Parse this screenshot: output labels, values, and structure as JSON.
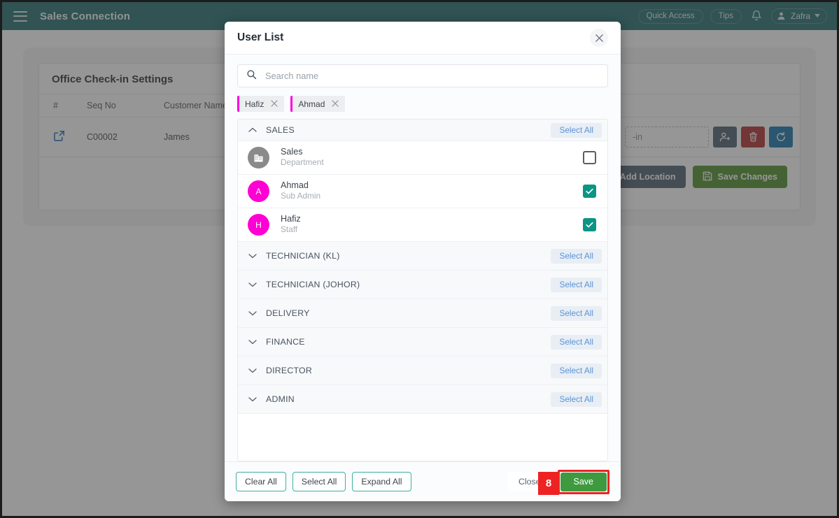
{
  "app": {
    "title": "Sales Connection",
    "menu_icon": "hamburger-icon",
    "header_actions": {
      "quick_access": "Quick Access",
      "tips": "Tips",
      "bell": "bell-icon",
      "user_name": "Zafra"
    }
  },
  "background": {
    "card_title": "Office Check-in Settings",
    "table": {
      "columns": [
        "#",
        "Seq No",
        "Customer Name"
      ],
      "rows": [
        {
          "icon": "external-link-icon",
          "seq_no": "C00002",
          "customer_name": "James"
        }
      ],
      "checkin_field_text": "-in"
    },
    "row_icon_buttons": [
      {
        "name": "assign-user-button",
        "icon": "user-add-icon",
        "color": "#4a5d6b"
      },
      {
        "name": "delete-button",
        "icon": "trash-icon",
        "color": "#b02a2a"
      },
      {
        "name": "refresh-button",
        "icon": "refresh-icon",
        "color": "#1271a8"
      }
    ],
    "buttons": {
      "add_location": "Add Location",
      "save_changes": "Save Changes"
    }
  },
  "modal": {
    "title": "User List",
    "close_icon": "close-icon",
    "search": {
      "placeholder": "Search name",
      "value": "",
      "icon": "search-icon"
    },
    "chips": [
      {
        "label": "Hafiz",
        "remove_icon": "close-icon"
      },
      {
        "label": "Ahmad",
        "remove_icon": "close-icon"
      }
    ],
    "select_all_label": "Select All",
    "groups": [
      {
        "name": "SALES",
        "expanded": true,
        "chevron": "chevron-up-icon",
        "members": [
          {
            "name": "Sales",
            "role": "Department",
            "avatar_type": "department",
            "avatar_initial": "",
            "checked": false
          },
          {
            "name": "Ahmad",
            "role": "Sub Admin",
            "avatar_type": "person",
            "avatar_initial": "A",
            "checked": true
          },
          {
            "name": "Hafiz",
            "role": "Staff",
            "avatar_type": "person",
            "avatar_initial": "H",
            "checked": true
          }
        ]
      },
      {
        "name": "TECHNICIAN (KL)",
        "expanded": false,
        "chevron": "chevron-down-icon",
        "members": []
      },
      {
        "name": "TECHNICIAN (JOHOR)",
        "expanded": false,
        "chevron": "chevron-down-icon",
        "members": []
      },
      {
        "name": "DELIVERY",
        "expanded": false,
        "chevron": "chevron-down-icon",
        "members": []
      },
      {
        "name": "FINANCE",
        "expanded": false,
        "chevron": "chevron-down-icon",
        "members": []
      },
      {
        "name": "DIRECTOR",
        "expanded": false,
        "chevron": "chevron-down-icon",
        "members": []
      },
      {
        "name": "ADMIN",
        "expanded": false,
        "chevron": "chevron-down-icon",
        "members": []
      }
    ],
    "footer": {
      "clear_all": "Clear All",
      "select_all": "Select All",
      "expand_all": "Expand All",
      "close": "Close",
      "save": "Save"
    }
  },
  "annotation": {
    "step_number": "8"
  },
  "colors": {
    "topbar": "#1f6a6a",
    "accent_teal": "#0c9484",
    "chip_bar": "#ff00e0",
    "avatar_person": "#ff00d4",
    "save_green": "#3f9a3f",
    "highlight_red": "#ee2222",
    "select_all_text": "#5a93d4"
  }
}
